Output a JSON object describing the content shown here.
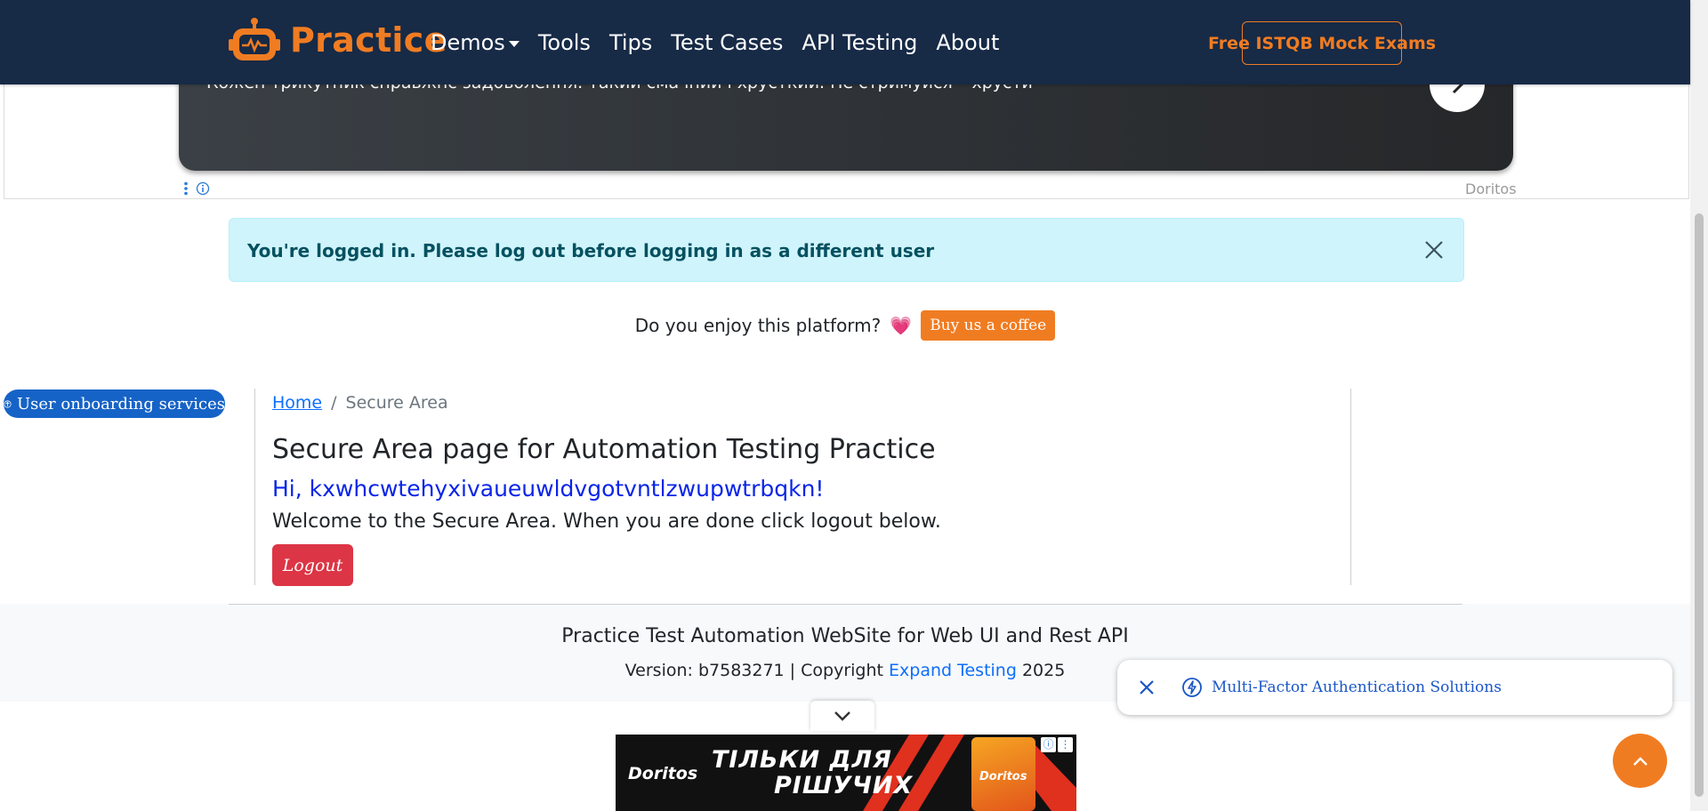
{
  "navbar": {
    "brand": "Practice",
    "items": [
      {
        "label": "Demos",
        "has_dropdown": true
      },
      {
        "label": "Tools"
      },
      {
        "label": "Tips"
      },
      {
        "label": "Test Cases"
      },
      {
        "label": "API Testing"
      },
      {
        "label": "About"
      }
    ],
    "cta": "Free ISTQB Mock Exams",
    "colors": {
      "background": "#172a46",
      "accent": "#f07c22"
    }
  },
  "ad_top": {
    "text": "Кожен трикутник справжнє задоволення. Такий смачний і хрусткий. Не стримуйся – хрусти",
    "advertiser": "Doritos"
  },
  "alert": {
    "message": "You're logged in. Please log out before logging in as a different user"
  },
  "coffee": {
    "question": "Do you enjoy this platform?",
    "heart": "💗",
    "button": "Buy us a coffee"
  },
  "onboarding": {
    "label": "User onboarding services"
  },
  "breadcrumb": {
    "home": "Home",
    "separator": "/",
    "current": "Secure Area"
  },
  "main": {
    "title": "Secure Area page for Automation Testing Practice",
    "greeting": "Hi, kxwhcwtehyxivaueuwldvgotvntlzwupwtrbqkn!",
    "welcome": "Welcome to the Secure Area. When you are done click logout below.",
    "logout_button": "Logout"
  },
  "footer": {
    "title": "Practice Test Automation WebSite for Web UI and Rest API",
    "version_prefix": "Version: b7583271 | Copyright ",
    "company": "Expand Testing",
    "year": " 2025"
  },
  "mfa_popup": {
    "label": "Multi-Factor Authentication Solutions"
  },
  "ad_bottom": {
    "logo": "Doritos",
    "headline_line1": "ТІЛЬКИ ДЛЯ",
    "headline_line2": "РІШУЧИХ"
  }
}
